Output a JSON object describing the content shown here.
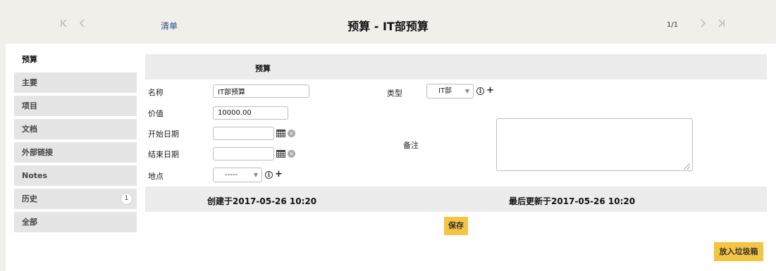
{
  "header": {
    "first_icon": "first-page-icon",
    "prev_icon": "prev-page-icon",
    "next_icon": "next-page-icon",
    "last_icon": "last-page-icon",
    "list_link": "清单",
    "title": "预算 - IT部预算",
    "pager": "1/1"
  },
  "sidebar": {
    "items": [
      {
        "label": "预算"
      },
      {
        "label": "主要"
      },
      {
        "label": "项目"
      },
      {
        "label": "文档"
      },
      {
        "label": "外部链接"
      },
      {
        "label": "Notes"
      },
      {
        "label": "历史",
        "badge": "1"
      },
      {
        "label": "全部"
      }
    ]
  },
  "form": {
    "section_title": "预算",
    "name": {
      "label": "名称",
      "value": "IT部预算"
    },
    "value": {
      "label": "价值",
      "value": "10000.00"
    },
    "start_date": {
      "label": "开始日期",
      "value": ""
    },
    "end_date": {
      "label": "结束日期",
      "value": ""
    },
    "location": {
      "label": "地点",
      "selected": "-----"
    },
    "type": {
      "label": "类型",
      "selected": "IT部"
    },
    "comment": {
      "label": "备注",
      "value": ""
    },
    "created": "创建于2017-05-26 10:20",
    "updated": "最后更新于2017-05-26 10:20"
  },
  "buttons": {
    "save": "保存",
    "trash": "放入垃圾箱"
  },
  "colors": {
    "accent_button": "#f6c443",
    "link": "#2a4f8c",
    "background": "#f1efea"
  }
}
